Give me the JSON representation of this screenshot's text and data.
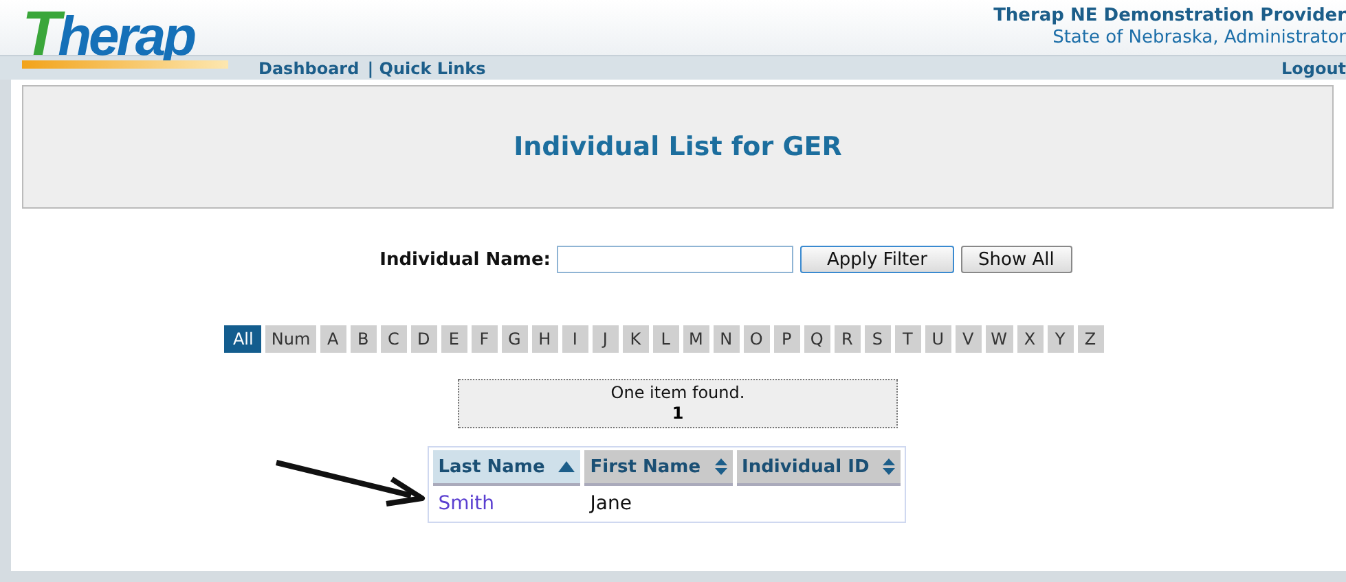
{
  "header": {
    "logo": "Therap",
    "nav_links": [
      "Dashboard",
      "| Quick Links"
    ],
    "provider": "Therap NE Demonstration Provider",
    "user": "State of Nebraska, Administrator",
    "logout": "Logout"
  },
  "page_title": "Individual List for GER",
  "filter": {
    "label": "Individual Name:",
    "buttons": [
      {
        "label": "Apply Filter",
        "focused": true
      },
      {
        "label": "Show All",
        "focused": false
      }
    ]
  },
  "letters": [
    {
      "label": "All",
      "selected": true
    },
    {
      "label": "Num",
      "selected": false
    },
    {
      "label": "A",
      "selected": false
    },
    {
      "label": "B",
      "selected": false
    },
    {
      "label": "C",
      "selected": false
    },
    {
      "label": "D",
      "selected": false
    },
    {
      "label": "E",
      "selected": false
    },
    {
      "label": "F",
      "selected": false
    },
    {
      "label": "G",
      "selected": false
    },
    {
      "label": "H",
      "selected": false
    },
    {
      "label": "I",
      "selected": false
    },
    {
      "label": "J",
      "selected": false
    },
    {
      "label": "K",
      "selected": false
    },
    {
      "label": "L",
      "selected": false
    },
    {
      "label": "M",
      "selected": false
    },
    {
      "label": "N",
      "selected": false
    },
    {
      "label": "O",
      "selected": false
    },
    {
      "label": "P",
      "selected": false
    },
    {
      "label": "Q",
      "selected": false
    },
    {
      "label": "R",
      "selected": false
    },
    {
      "label": "S",
      "selected": false
    },
    {
      "label": "T",
      "selected": false
    },
    {
      "label": "U",
      "selected": false
    },
    {
      "label": "V",
      "selected": false
    },
    {
      "label": "W",
      "selected": false
    },
    {
      "label": "X",
      "selected": false
    },
    {
      "label": "Y",
      "selected": false
    },
    {
      "label": "Z",
      "selected": false
    }
  ],
  "result": {
    "message": "One item found.",
    "page": "1"
  },
  "table": {
    "columns": [
      {
        "label": "Last Name",
        "sorted": true
      },
      {
        "label": "First Name",
        "sorted": false
      },
      {
        "label": "Individual ID",
        "sorted": false
      }
    ],
    "rows": [
      {
        "last_name": "Smith",
        "first_name": "Jane"
      }
    ]
  }
}
